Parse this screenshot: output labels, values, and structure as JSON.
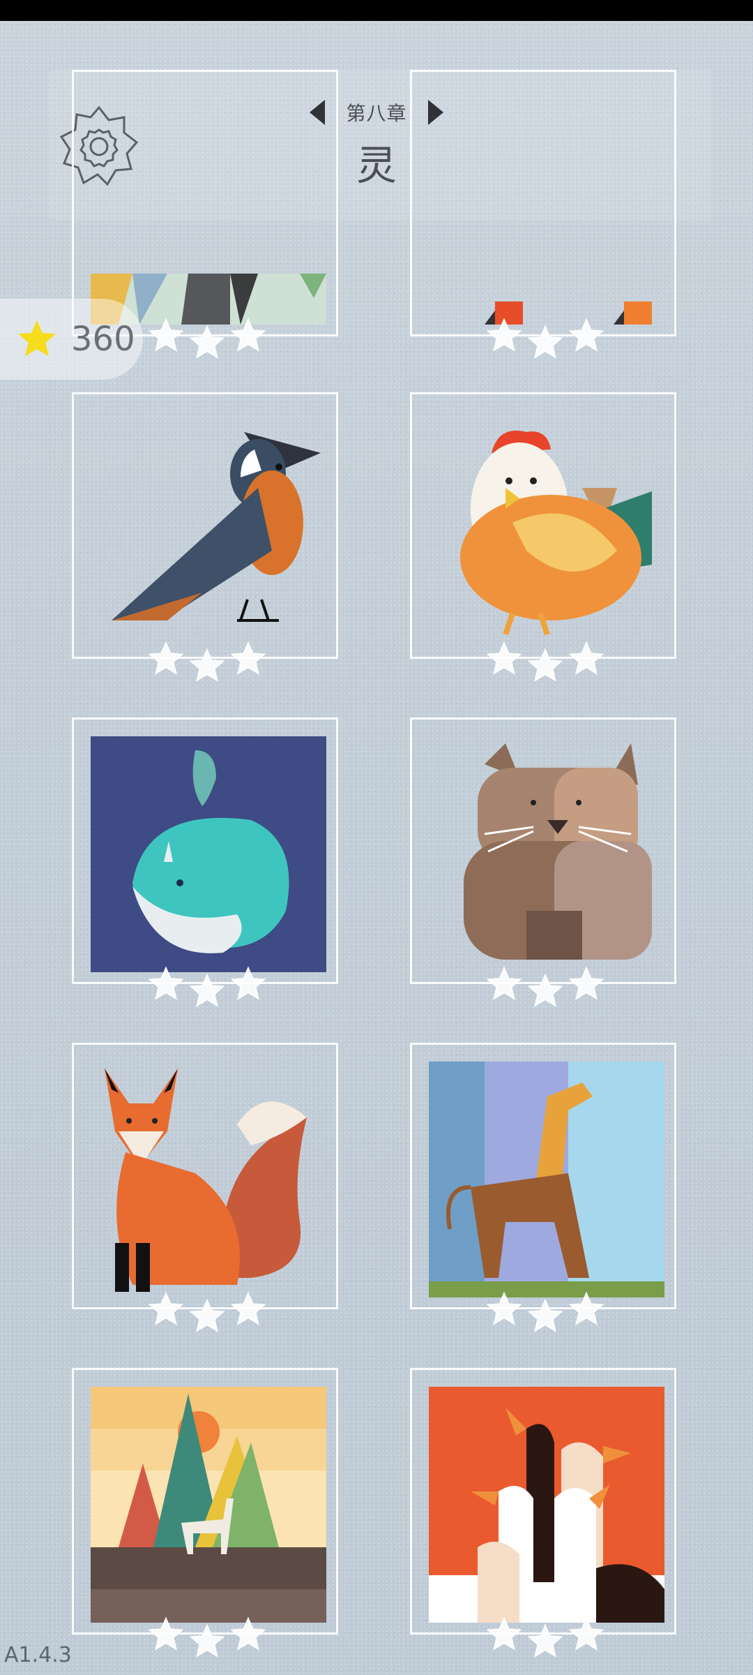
{
  "header": {
    "chapter_label": "第八章",
    "chapter_title": "灵"
  },
  "score": {
    "value": "360",
    "icon": "star-icon",
    "star_color": "#f5dc1c"
  },
  "icons": {
    "settings": "gear-icon",
    "prev": "caret-left-icon",
    "next": "caret-right-icon"
  },
  "puzzles": [
    {
      "name": "abstract-shapes",
      "stars": 3
    },
    {
      "name": "orange-shapes",
      "stars": 3
    },
    {
      "name": "bird",
      "stars": 3
    },
    {
      "name": "chicken",
      "stars": 3
    },
    {
      "name": "whale",
      "stars": 3
    },
    {
      "name": "wombat",
      "stars": 3
    },
    {
      "name": "fox",
      "stars": 3
    },
    {
      "name": "giraffe",
      "stars": 3
    },
    {
      "name": "deer-mountains",
      "stars": 3
    },
    {
      "name": "geese",
      "stars": 3
    }
  ],
  "footer": {
    "version": "A1.4.3"
  }
}
